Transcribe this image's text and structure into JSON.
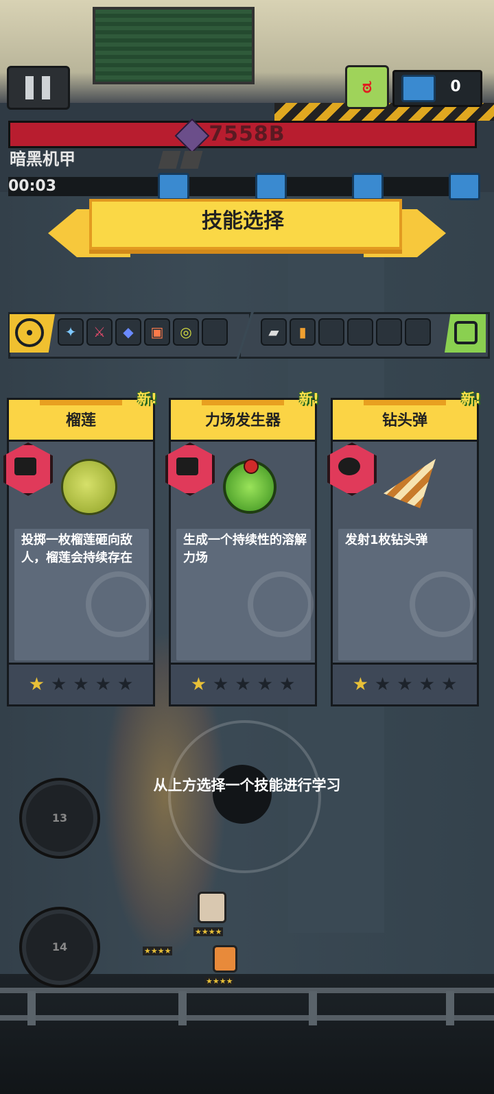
{
  "hud": {
    "boss_hp_value": "7558B",
    "boss_name": "暗黑机甲",
    "timer": "00:03",
    "chest_count": "0"
  },
  "banner": {
    "title": "技能选择"
  },
  "skill_bar": {
    "attack_slots": [
      "magic-wand",
      "crimson-blade",
      "blue-crystal",
      "fire-scroll",
      "yellow-disc",
      "empty"
    ],
    "passive_slots": [
      "sneaker",
      "battery",
      "empty",
      "empty",
      "empty",
      "empty"
    ]
  },
  "cards": [
    {
      "new_label": "新!",
      "title": "榴莲",
      "badge_icon": "robot-icon",
      "art_icon": "durian-icon",
      "description": "投掷一枚榴莲砸向敌人，榴莲会持续存在",
      "stars": 1,
      "max_stars": 5
    },
    {
      "new_label": "新!",
      "title": "力场发生器",
      "badge_icon": "machine-icon",
      "art_icon": "force-field-icon",
      "description": "生成一个持续性的溶解力场",
      "stars": 1,
      "max_stars": 5
    },
    {
      "new_label": "新!",
      "title": "钻头弹",
      "badge_icon": "gear-icon",
      "art_icon": "drill-icon",
      "description": "发射1枚钻头弹",
      "stars": 1,
      "max_stars": 5
    }
  ],
  "hint": "从上方选择一个技能进行学习",
  "controls": {
    "skill_1_cooldown": "13",
    "skill_2_cooldown": "14"
  },
  "colors": {
    "banner": "#fad846",
    "card_header": "#fbd445",
    "hp_bar": "#b81d2f",
    "star_on": "#e8c038",
    "badge": "#e03a5a"
  }
}
